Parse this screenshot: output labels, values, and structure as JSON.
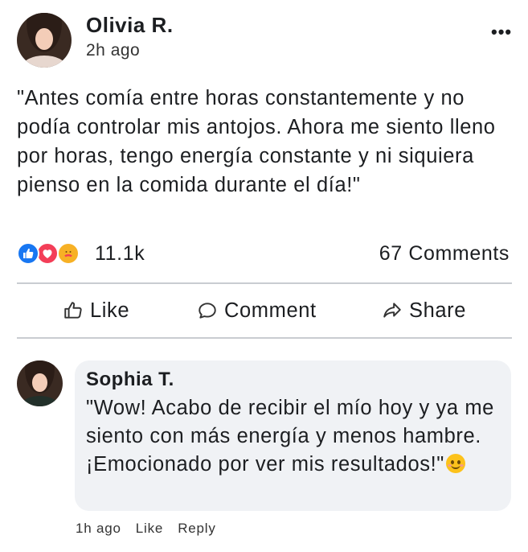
{
  "post": {
    "author": "Olivia R.",
    "time": "2h ago",
    "more_label": "•••",
    "text": "\"Antes comía entre horas constantemente y no podía controlar mis antojos. Ahora me siento lleno por horas, tengo energía constante y ni siquiera pienso en la comida durante el día!\"",
    "reactions": {
      "icons": [
        "like-icon",
        "love-icon",
        "care-icon"
      ],
      "count": "11.1k"
    },
    "comments_count": "67 Comments"
  },
  "actions": {
    "like": "Like",
    "comment": "Comment",
    "share": "Share"
  },
  "comment": {
    "author": "Sophia T.",
    "text": "\"Wow! Acabo de recibir el mío hoy y ya me siento con más energía y menos hambre. ¡Emocionado por ver mis resultados!\"",
    "emoji": "smiling-face-icon",
    "time": "1h ago",
    "like": "Like",
    "reply": "Reply"
  },
  "colors": {
    "like": "#1877f2",
    "love": "#f33e58",
    "care": "#f7b125",
    "bubble": "#f0f2f5",
    "divider": "#c9ccd1"
  }
}
